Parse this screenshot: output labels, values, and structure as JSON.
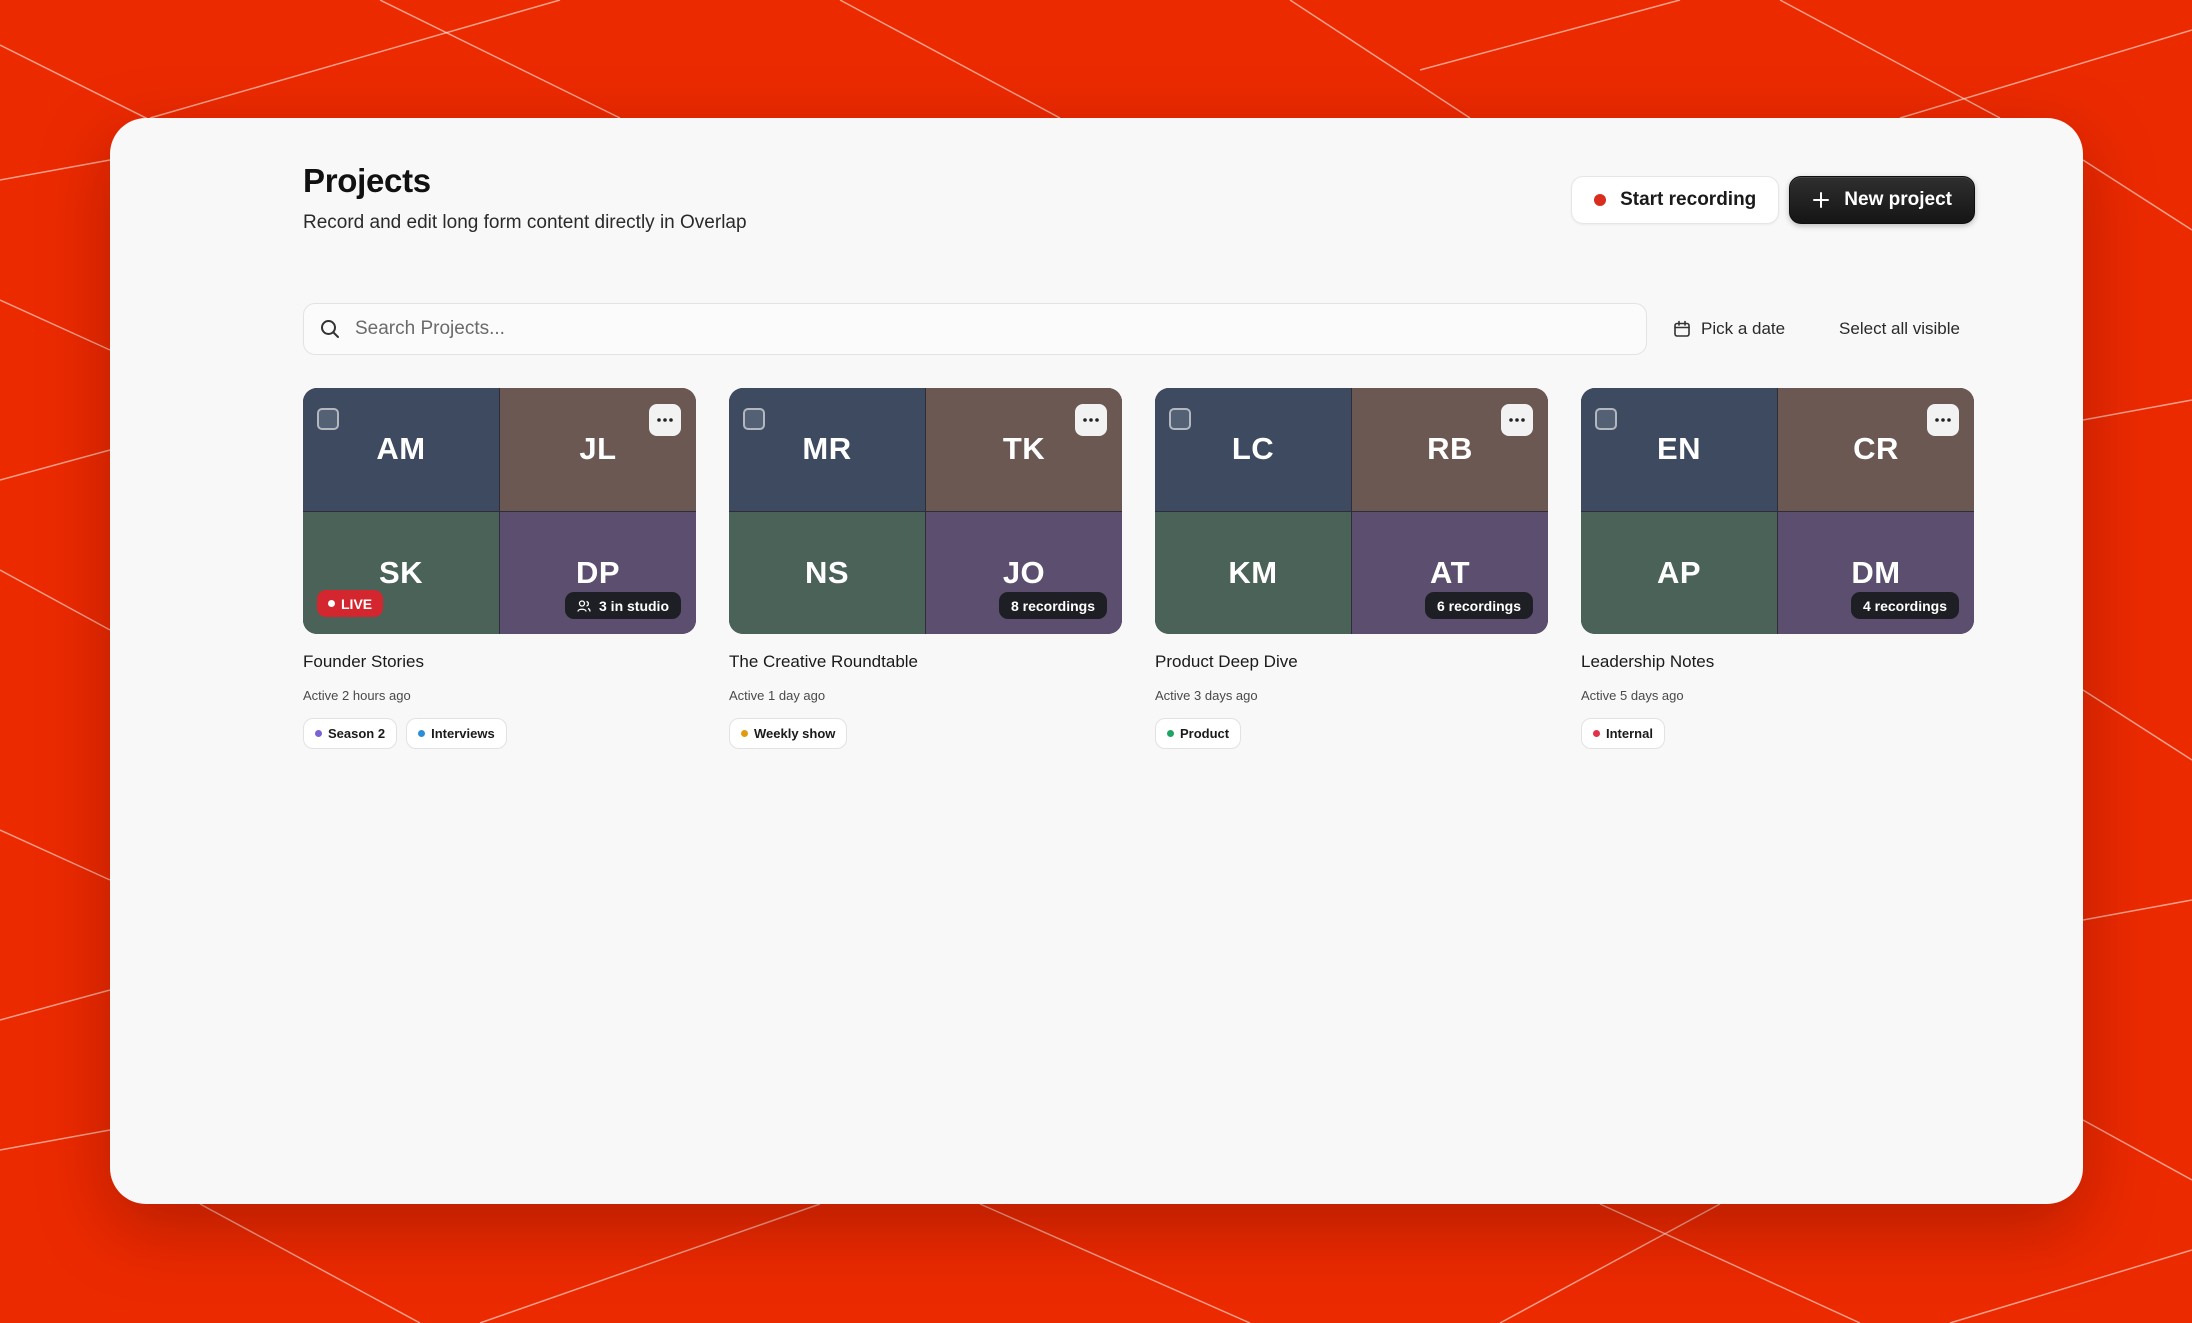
{
  "header": {
    "title": "Projects",
    "subtitle": "Record and edit long form content directly in Overlap",
    "start_recording_label": "Start recording",
    "new_project_label": "New project"
  },
  "toolbar": {
    "search_placeholder": "Search Projects...",
    "date_label": "Pick a date",
    "select_all_label": "Select all visible"
  },
  "colors": {
    "background": "#ec2a00",
    "recording_dot": "#d92d20",
    "live_badge": "#d4262e"
  },
  "projects": [
    {
      "title": "Founder Stories",
      "active": "Active 2 hours ago",
      "participants": [
        "AM",
        "JL",
        "SK",
        "DP"
      ],
      "live_label": "LIVE",
      "badge": "3 in studio",
      "tags": [
        {
          "label": "Season 2",
          "color": "#7b61d6"
        },
        {
          "label": "Interviews",
          "color": "#2b8fd6"
        }
      ]
    },
    {
      "title": "The Creative Roundtable",
      "active": "Active 1 day ago",
      "participants": [
        "MR",
        "TK",
        "NS",
        "JO"
      ],
      "badge": "8 recordings",
      "tags": [
        {
          "label": "Weekly show",
          "color": "#e29a12"
        }
      ]
    },
    {
      "title": "Product Deep Dive",
      "active": "Active 3 days ago",
      "participants": [
        "LC",
        "RB",
        "KM",
        "AT"
      ],
      "badge": "6 recordings",
      "tags": [
        {
          "label": "Product",
          "color": "#1fa463"
        }
      ]
    },
    {
      "title": "Leadership Notes",
      "active": "Active 5 days ago",
      "participants": [
        "EN",
        "CR",
        "AP",
        "DM"
      ],
      "badge": "4 recordings",
      "tags": [
        {
          "label": "Internal",
          "color": "#e0334a"
        }
      ]
    }
  ]
}
